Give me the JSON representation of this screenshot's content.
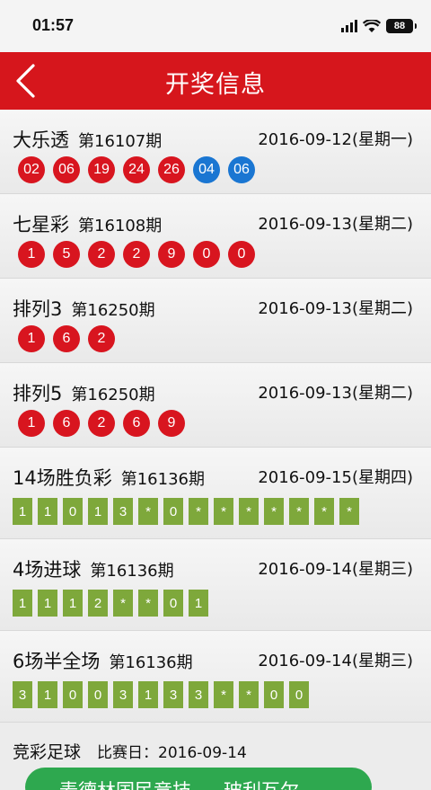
{
  "status_bar": {
    "time": "01:57",
    "battery": "88"
  },
  "nav": {
    "title": "开奖信息"
  },
  "lotteries": [
    {
      "name": "大乐透",
      "issue": "第16107期",
      "date": "2016-09-12(星期一)",
      "kind": "balls",
      "numbers": [
        {
          "v": "02",
          "c": "red"
        },
        {
          "v": "06",
          "c": "red"
        },
        {
          "v": "19",
          "c": "red"
        },
        {
          "v": "24",
          "c": "red"
        },
        {
          "v": "26",
          "c": "red"
        },
        {
          "v": "04",
          "c": "blue"
        },
        {
          "v": "06",
          "c": "blue"
        }
      ]
    },
    {
      "name": "七星彩",
      "issue": "第16108期",
      "date": "2016-09-13(星期二)",
      "kind": "balls",
      "numbers": [
        {
          "v": "1",
          "c": "red"
        },
        {
          "v": "5",
          "c": "red"
        },
        {
          "v": "2",
          "c": "red"
        },
        {
          "v": "2",
          "c": "red"
        },
        {
          "v": "9",
          "c": "red"
        },
        {
          "v": "0",
          "c": "red"
        },
        {
          "v": "0",
          "c": "red"
        }
      ]
    },
    {
      "name": "排列3",
      "issue": "第16250期",
      "date": "2016-09-13(星期二)",
      "kind": "balls",
      "numbers": [
        {
          "v": "1",
          "c": "red"
        },
        {
          "v": "6",
          "c": "red"
        },
        {
          "v": "2",
          "c": "red"
        }
      ]
    },
    {
      "name": "排列5",
      "issue": "第16250期",
      "date": "2016-09-13(星期二)",
      "kind": "balls",
      "numbers": [
        {
          "v": "1",
          "c": "red"
        },
        {
          "v": "6",
          "c": "red"
        },
        {
          "v": "2",
          "c": "red"
        },
        {
          "v": "6",
          "c": "red"
        },
        {
          "v": "9",
          "c": "red"
        }
      ]
    },
    {
      "name": "14场胜负彩",
      "issue": "第16136期",
      "date": "2016-09-15(星期四)",
      "kind": "cells",
      "numbers": [
        "1",
        "1",
        "0",
        "1",
        "3",
        "*",
        "0",
        "*",
        "*",
        "*",
        "*",
        "*",
        "*",
        "*"
      ]
    },
    {
      "name": "4场进球",
      "issue": "第16136期",
      "date": "2016-09-14(星期三)",
      "kind": "cells",
      "numbers": [
        "1",
        "1",
        "1",
        "2",
        "*",
        "*",
        "0",
        "1"
      ]
    },
    {
      "name": "6场半全场",
      "issue": "第16136期",
      "date": "2016-09-14(星期三)",
      "kind": "cells",
      "numbers": [
        "3",
        "1",
        "0",
        "0",
        "3",
        "1",
        "3",
        "3",
        "*",
        "*",
        "0",
        "0"
      ]
    }
  ],
  "soccer": {
    "title": "竞彩足球",
    "day_label": "比赛日：2016-09-14",
    "home": "麦德林国民竞技",
    "away": "玻利瓦尔"
  }
}
